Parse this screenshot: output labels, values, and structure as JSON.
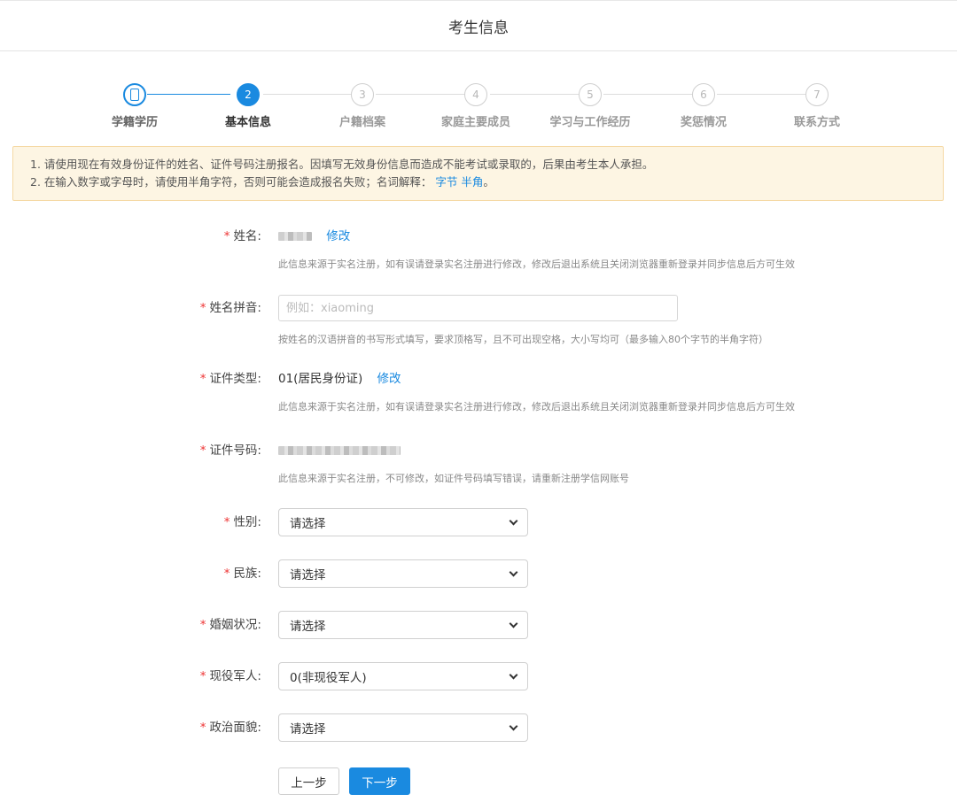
{
  "header": {
    "title": "考生信息"
  },
  "steps": [
    {
      "num": "",
      "label": "学籍学历",
      "state": "done"
    },
    {
      "num": "2",
      "label": "基本信息",
      "state": "active"
    },
    {
      "num": "3",
      "label": "户籍档案",
      "state": "pending"
    },
    {
      "num": "4",
      "label": "家庭主要成员",
      "state": "pending"
    },
    {
      "num": "5",
      "label": "学习与工作经历",
      "state": "pending"
    },
    {
      "num": "6",
      "label": "奖惩情况",
      "state": "pending"
    },
    {
      "num": "7",
      "label": "联系方式",
      "state": "pending"
    }
  ],
  "notice": {
    "line1": "1. 请使用现在有效身份证件的姓名、证件号码注册报名。因填写无效身份信息而造成不能考试或录取的，后果由考生本人承担。",
    "line2": "2. 在输入数字或字母时，请使用半角字符，否则可能会造成报名失败；名词解释：",
    "link1": "字节",
    "link2": "半角",
    "period": "。"
  },
  "form": {
    "required_mark": "*",
    "name": {
      "label": "姓名:",
      "edit": "修改",
      "hint": "此信息来源于实名注册，如有误请登录实名注册进行修改，修改后退出系统且关闭浏览器重新登录并同步信息后方可生效"
    },
    "pinyin": {
      "label": "姓名拼音:",
      "placeholder": "例如：xiaoming",
      "hint": "按姓名的汉语拼音的书写形式填写，要求顶格写，且不可出现空格，大小写均可（最多输入80个字节的半角字符）"
    },
    "id_type": {
      "label": "证件类型:",
      "value": "01(居民身份证)",
      "edit": "修改",
      "hint": "此信息来源于实名注册，如有误请登录实名注册进行修改，修改后退出系统且关闭浏览器重新登录并同步信息后方可生效"
    },
    "id_number": {
      "label": "证件号码:",
      "hint": "此信息来源于实名注册，不可修改，如证件号码填写错误，请重新注册学信网账号"
    },
    "gender": {
      "label": "性别:",
      "value": "请选择"
    },
    "ethnicity": {
      "label": "民族:",
      "value": "请选择"
    },
    "marital": {
      "label": "婚姻状况:",
      "value": "请选择"
    },
    "military": {
      "label": "现役军人:",
      "value": "0(非现役军人)"
    },
    "political": {
      "label": "政治面貌:",
      "value": "请选择"
    }
  },
  "buttons": {
    "prev": "上一步",
    "next": "下一步"
  },
  "colors": {
    "accent": "#1a8ae0",
    "required": "#ee3333",
    "notice_bg": "#fdf5e3"
  }
}
